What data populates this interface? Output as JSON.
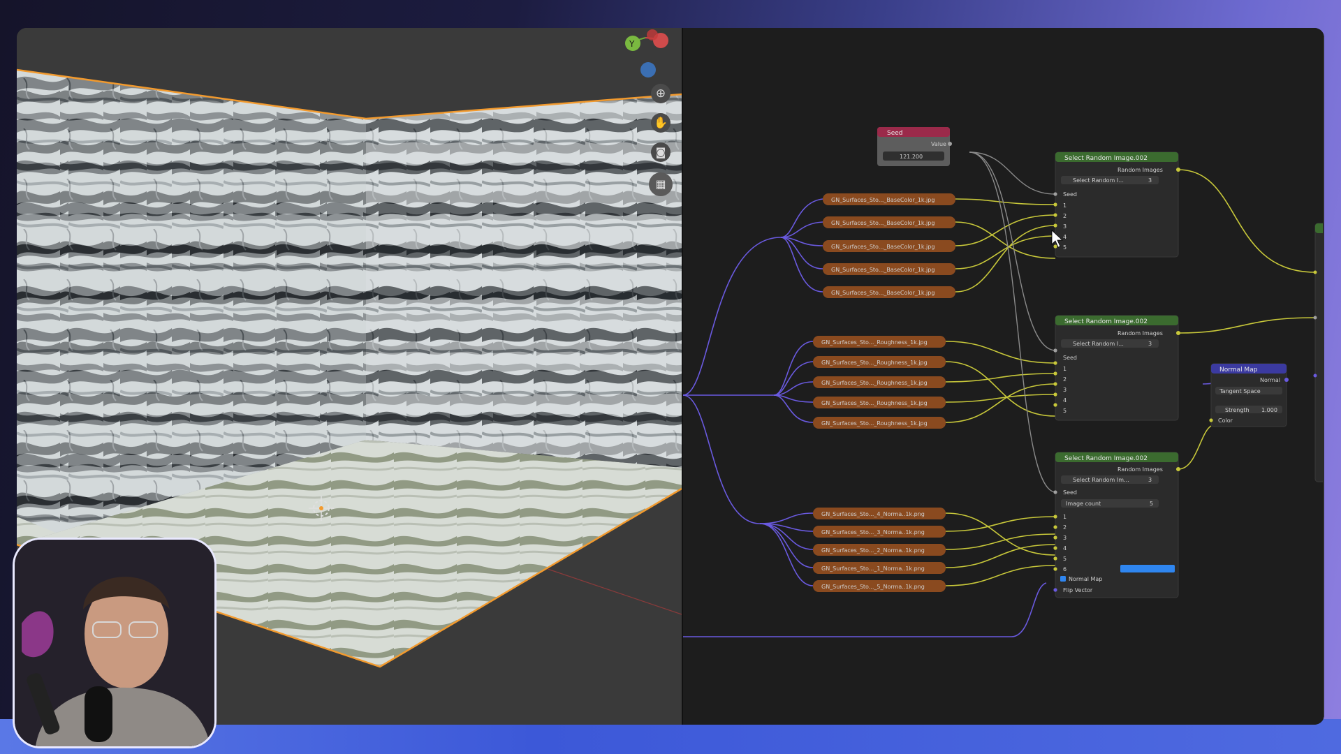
{
  "viewport": {
    "navigation": {
      "gizmo_axis_y": "Y",
      "icons": [
        "zoom-icon",
        "hand-pan-icon",
        "camera-icon",
        "grid-view-icon"
      ]
    }
  },
  "nodes": {
    "seed": {
      "title": "Seed",
      "output_label": "Value",
      "value": "121.200"
    },
    "base_color_images": [
      "GN_Surfaces_Sto..._BaseColor_1k.jpg",
      "GN_Surfaces_Sto..._BaseColor_1k.jpg",
      "GN_Surfaces_Sto..._BaseColor_1k.jpg",
      "GN_Surfaces_Sto..._BaseColor_1k.jpg",
      "GN_Surfaces_Sto..._BaseColor_1k.jpg"
    ],
    "roughness_images": [
      "GN_Surfaces_Sto..._Roughness_1k.jpg",
      "GN_Surfaces_Sto..._Roughness_1k.jpg",
      "GN_Surfaces_Sto..._Roughness_1k.jpg",
      "GN_Surfaces_Sto..._Roughness_1k.jpg",
      "GN_Surfaces_Sto..._Roughness_1k.jpg"
    ],
    "normal_images": [
      "GN_Surfaces_Sto..._4_Norma..1k.png",
      "GN_Surfaces_Sto..._3_Norma..1k.png",
      "GN_Surfaces_Sto..._2_Norma..1k.png",
      "GN_Surfaces_Sto..._1_Norma..1k.png",
      "GN_Surfaces_Sto..._5_Norma..1k.png"
    ],
    "select_random_1": {
      "title": "Select Random Image.002",
      "output": "Random Images",
      "group": "Select Random I...",
      "count": "3",
      "seed_label": "Seed",
      "inputs": [
        "1",
        "2",
        "3",
        "4",
        "5"
      ]
    },
    "select_random_2": {
      "title": "Select Random Image.002",
      "output": "Random Images",
      "group": "Select Random I...",
      "count": "3",
      "seed_label": "Seed",
      "inputs": [
        "1",
        "2",
        "3",
        "4",
        "5"
      ]
    },
    "select_random_3": {
      "title": "Select Random Image.002",
      "output": "Random Images",
      "group": "Select Random Im...",
      "count": "3",
      "seed_label": "Seed",
      "image_count_label": "Image count",
      "image_count_value": "5",
      "inputs": [
        "1",
        "2",
        "3",
        "4",
        "5",
        "6"
      ],
      "normal_map_label": "Normal Map",
      "flip_vector_label": "Flip Vector"
    },
    "normal_map": {
      "title": "Normal Map",
      "output": "Normal",
      "space": "Tangent Space",
      "strength_label": "Strength",
      "strength_value": "1.000",
      "color_label": "Color"
    }
  },
  "colors": {
    "image_node": "#8a4a1f",
    "group_header": "#3b6b2f",
    "seed_header": "#9b2a4a",
    "vector_header": "#3b3aa0",
    "link_yellow": "#c8c83a",
    "link_purple": "#6a5ae0",
    "link_grey": "#8a8a8a",
    "selection_orange": "#f29a2e",
    "accent_blue": "#2f86f0"
  }
}
